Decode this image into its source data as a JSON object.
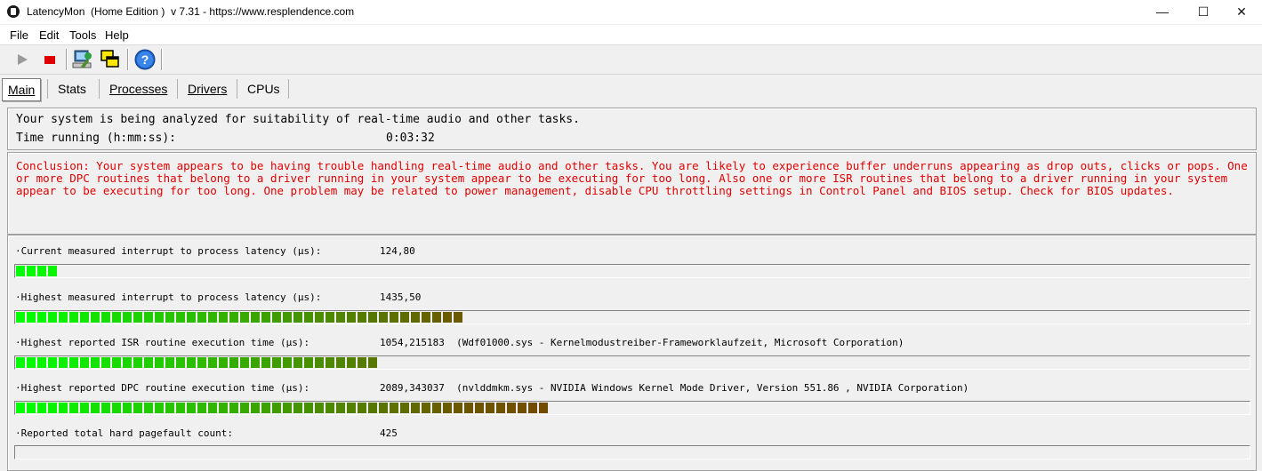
{
  "window": {
    "title": "LatencyMon  (Home Edition )  v 7.31 - https://www.resplendence.com",
    "minimize": "—",
    "maximize": "☐",
    "close": "✕"
  },
  "menu": [
    {
      "label": "File"
    },
    {
      "label": "Edit"
    },
    {
      "label": "Tools"
    },
    {
      "label": "Help"
    }
  ],
  "toolbar": {
    "play_icon": "play-icon",
    "stop_icon": "stop-icon",
    "cpu_icon": "computer-icon",
    "windows_icon": "windows-icon",
    "help_icon": "help-icon",
    "help_glyph": "?"
  },
  "tabs": [
    {
      "label": "Main",
      "active": true
    },
    {
      "label": "Stats"
    },
    {
      "label": "Processes"
    },
    {
      "label": "Drivers"
    },
    {
      "label": "CPUs"
    }
  ],
  "status": {
    "analyzing": "Your system is being analyzed for suitability of real-time audio and other tasks.",
    "time_label": "Time running (h:mm:ss):",
    "time_value": "0:03:32"
  },
  "conclusion": "Conclusion: Your system appears to be having trouble handling real-time audio and other tasks. You are likely to experience buffer underruns appearing as drop outs, clicks or pops. One or more DPC routines that belong to a driver running in your system appear to be executing for too long. Also one or more ISR routines that belong to a driver running in your system appear to be executing for too long. One problem may be related to power management, disable CPU throttling settings in Control Panel and BIOS setup. Check for BIOS updates.",
  "colors": {
    "conclusion_text": "#e00000",
    "bar_green": "#00ff00",
    "bar_olive": "#6b5a00",
    "bar_brown": "#7a3a00"
  },
  "metrics": [
    {
      "label": "·Current measured interrupt to process latency (µs):",
      "value": "124,80",
      "bar_fraction": 0.036
    },
    {
      "label": "·Highest measured interrupt to process latency (µs):",
      "value": "1435,50",
      "bar_fraction": 0.371
    },
    {
      "label": "·Highest reported ISR routine execution time (µs):",
      "value": "1054,215183  (Wdf01000.sys - Kernelmodustreiber-Frameworklaufzeit, Microsoft Corporation)",
      "bar_fraction": 0.301
    },
    {
      "label": "·Highest reported DPC routine execution time (µs):",
      "value": "2089,343037  (nvlddmkm.sys - NVIDIA Windows Kernel Mode Driver, Version 551.86 , NVIDIA Corporation)",
      "bar_fraction": 0.44
    },
    {
      "label": "·Reported total hard pagefault count:",
      "value": "425",
      "bar_fraction": 0
    }
  ]
}
